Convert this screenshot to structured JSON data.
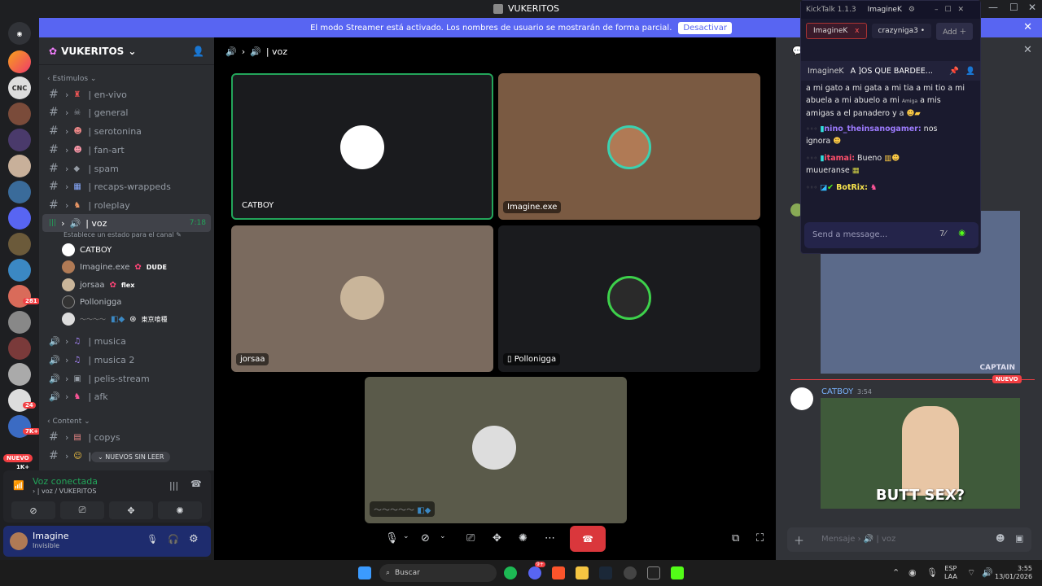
{
  "window": {
    "title": "VUKERITOS"
  },
  "banner": {
    "text": "El modo Streamer está activado. Los nombres de usuario se mostrarán de forma parcial.",
    "button": "Desactivar"
  },
  "servers": {
    "badges": [
      "281",
      "24",
      "7K+",
      "NUEVO",
      "1K+"
    ]
  },
  "server": {
    "name": "VUKERITOS"
  },
  "categories": {
    "estimulos": "Estimulos",
    "content": "Content"
  },
  "channels": [
    {
      "name": "| en-vivo"
    },
    {
      "name": "| general"
    },
    {
      "name": "| serotonina"
    },
    {
      "name": "| fan-art"
    },
    {
      "name": "| spam"
    },
    {
      "name": "| recaps-wrappeds"
    },
    {
      "name": "| roleplay"
    }
  ],
  "voice_channel": {
    "name": "| voz",
    "time": "7:18",
    "status": "Establece un estado para el canal"
  },
  "voice_users": [
    {
      "name": "CATBOY",
      "tag": ""
    },
    {
      "name": "Imagine.exe",
      "tag": "DUDE"
    },
    {
      "name": "jorsaa",
      "tag": "flex"
    },
    {
      "name": "Pollonigga",
      "tag": ""
    },
    {
      "name": "",
      "tag": "東京喰種"
    }
  ],
  "voice_channels_more": [
    {
      "name": "| musica"
    },
    {
      "name": "| musica 2"
    },
    {
      "name": "| pelis-stream"
    },
    {
      "name": "| afk"
    }
  ],
  "content_channels": [
    {
      "name": "| copys"
    },
    {
      "name": "|"
    }
  ],
  "nuevos_pill": "NUEVOS SIN LEER",
  "voice_status": {
    "title": "Voz conectada",
    "sub": "| voz / VUKERITOS"
  },
  "user": {
    "name": "Imagine",
    "status": "Invisible"
  },
  "stage": {
    "channel": "| voz",
    "tiles": [
      "CATBOY",
      "Imagine.exe",
      "jorsaa",
      "Pollonigga"
    ]
  },
  "kicktalk": {
    "title": "KickTalk 1.1.3",
    "user": "ImagineK",
    "tabs": [
      "ImagineK",
      "crazyniga3",
      "Add"
    ],
    "pinned": {
      "user": "ImagineK",
      "text": "A ]OS QUE BARDEE..."
    },
    "lines": [
      "a mi gato a mi gata a mi tia a mi tio a mi",
      "abuela a mi abuelo a mi",
      "a mis",
      "amigas a el panadero y a"
    ],
    "msgs": [
      {
        "user": "nino_theinsanogamer:",
        "text": "nos",
        "cont": "ignora",
        "color": "#9d7bff"
      },
      {
        "user": "itamai:",
        "text": "Bueno",
        "cont": "muueranse",
        "color": "#ff4f6b"
      },
      {
        "user": "BotRix:",
        "text": "",
        "cont": "",
        "color": "#f7e34d"
      }
    ],
    "emote_label": "Amiga",
    "input": "Send a message..."
  },
  "chat": {
    "new": "NUEVO",
    "author": "CATBOY",
    "time": "3:54",
    "caption": "BUTT SEX?",
    "gif_watermark": "CAPTAIN",
    "input": "Mensaje",
    "input_channel": "| voz"
  },
  "taskbar": {
    "search": "Buscar",
    "lang1": "ESP",
    "lang2": "LAA",
    "time": "3:55",
    "date": "13/01/2026",
    "notif_count": "9+"
  },
  "colors": {
    "blurple": "#5865f2",
    "green": "#23a55a",
    "red": "#da373c",
    "kick": "#53fc18"
  }
}
